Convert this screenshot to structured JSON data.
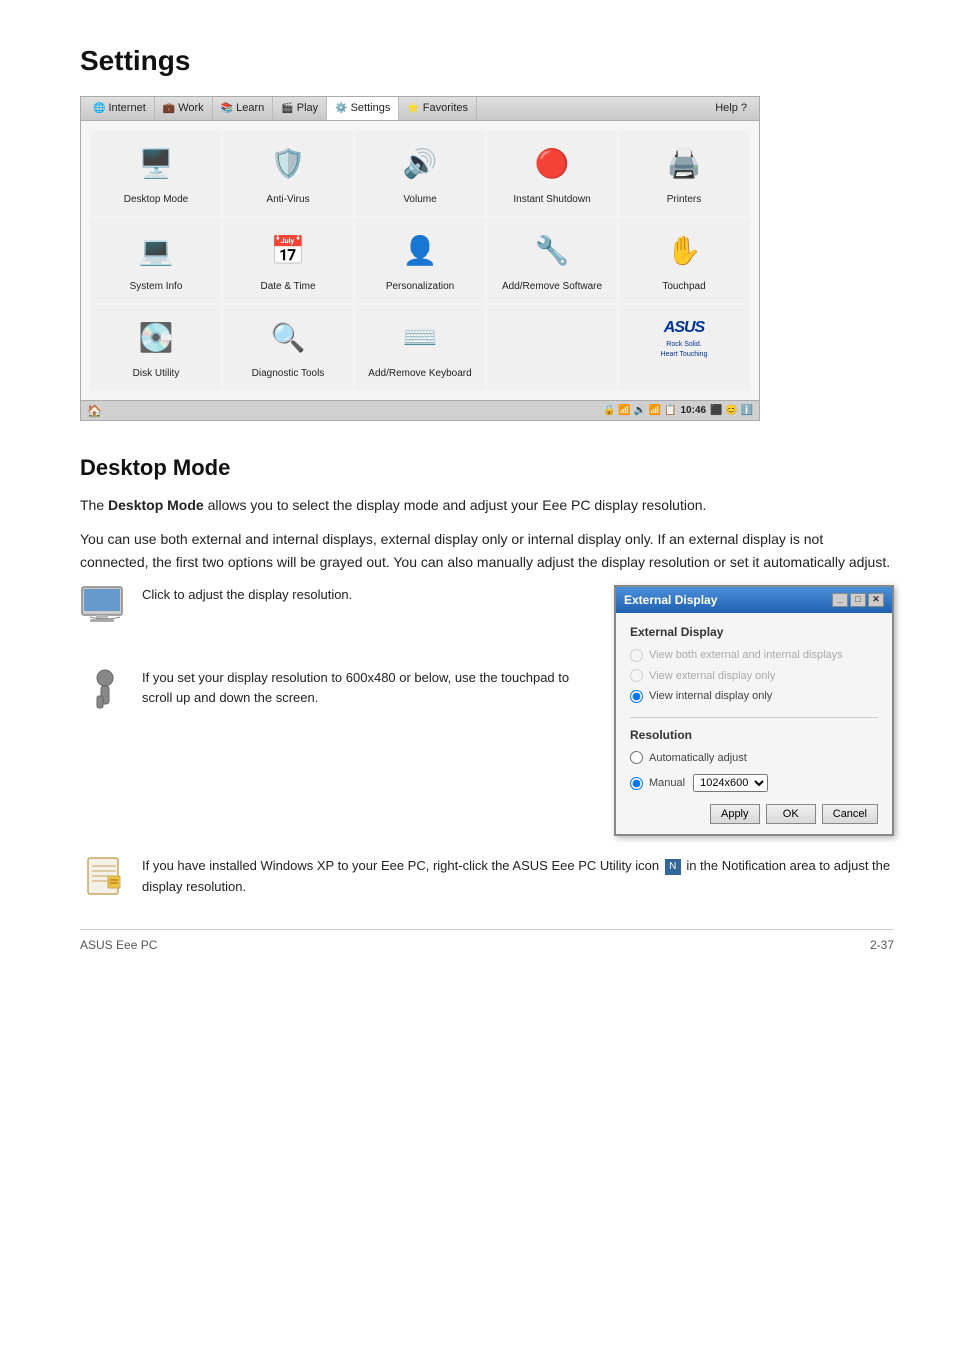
{
  "page": {
    "title": "Settings",
    "footer_left": "ASUS Eee PC",
    "footer_right": "2-37"
  },
  "navbar": {
    "items": [
      {
        "label": "Internet",
        "icon": "🌐",
        "active": false
      },
      {
        "label": "Work",
        "icon": "💼",
        "active": false
      },
      {
        "label": "Learn",
        "icon": "📚",
        "active": false
      },
      {
        "label": "Play",
        "icon": "🎬",
        "active": false
      },
      {
        "label": "Settings",
        "icon": "⚙️",
        "active": true
      },
      {
        "label": "Favorites",
        "icon": "⭐",
        "active": false
      }
    ],
    "help_label": "Help ?"
  },
  "settings_grid": {
    "items": [
      {
        "label": "Desktop Mode",
        "icon": "🖥️"
      },
      {
        "label": "Anti-Virus",
        "icon": "🛡️"
      },
      {
        "label": "Volume",
        "icon": "🔊"
      },
      {
        "label": "Instant Shutdown",
        "icon": "🔴"
      },
      {
        "label": "Printers",
        "icon": "🖨️"
      },
      {
        "label": "System Info",
        "icon": "💻"
      },
      {
        "label": "Date & Time",
        "icon": "📅"
      },
      {
        "label": "Personalization",
        "icon": "👤"
      },
      {
        "label": "Add/Remove Software",
        "icon": "🔧"
      },
      {
        "label": "Touchpad",
        "icon": "✋"
      },
      {
        "label": "Disk Utility",
        "icon": "💽"
      },
      {
        "label": "Diagnostic Tools",
        "icon": "🔍"
      },
      {
        "label": "Add/Remove Keyboard",
        "icon": "⌨️"
      },
      {
        "label": "",
        "icon": ""
      },
      {
        "label": "ASUS",
        "icon": "asus"
      }
    ]
  },
  "statusbar": {
    "left_icon": "🏠",
    "time": "10:46"
  },
  "section": {
    "title": "Desktop Mode",
    "para1_before": "The ",
    "para1_bold": "Desktop Mode",
    "para1_after": " allows you to select the display mode and adjust your Eee PC display resolution.",
    "para2": "You can use both external and internal displays, external display only or internal display only. If an external display is not connected, the first two options will be grayed out. You can also manually adjust the display resolution or set it automatically adjust."
  },
  "info_click": {
    "text": "Click to adjust the display resolution."
  },
  "info_touchpad": {
    "text": "If you set your display resolution to 600x480 or below, use the touchpad to scroll up and down the screen."
  },
  "dialog": {
    "title": "External Display",
    "section1_label": "External Display",
    "radio_options": [
      {
        "label": "View both external and internal displays",
        "disabled": true,
        "checked": false
      },
      {
        "label": "View external display only",
        "disabled": true,
        "checked": false
      },
      {
        "label": "View internal display only",
        "disabled": false,
        "checked": true
      }
    ],
    "section2_label": "Resolution",
    "resolution_options": [
      {
        "label": "Automatically adjust",
        "checked": false
      },
      {
        "label": "Manual",
        "checked": true
      }
    ],
    "resolution_value": "1024x600",
    "btn_apply": "Apply",
    "btn_ok": "OK",
    "btn_cancel": "Cancel"
  },
  "note": {
    "text_before": "If you have installed Windows XP to your Eee PC, right-click the ASUS Eee PC Utility icon ",
    "text_icon": "N",
    "text_after": " in the Notification area to adjust the display resolution."
  }
}
